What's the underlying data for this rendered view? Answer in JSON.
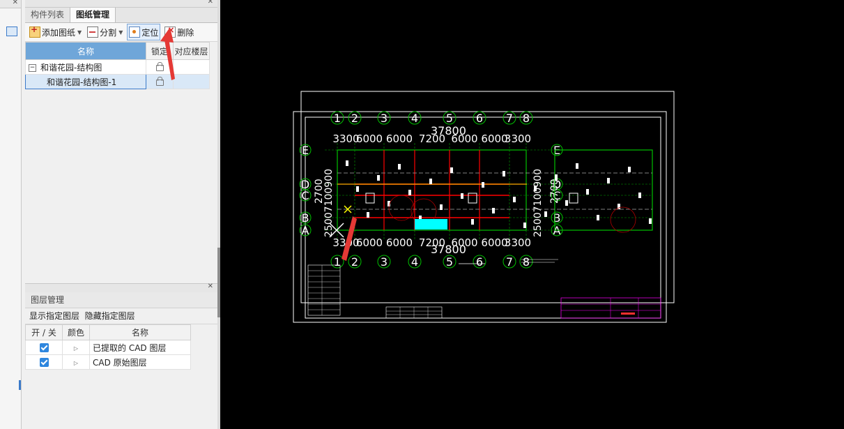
{
  "tabs": [
    {
      "label": "构件列表"
    },
    {
      "label": "图纸管理"
    }
  ],
  "toolbar": {
    "add_label": "添加图纸",
    "split_label": "分割",
    "locate_label": "定位",
    "delete_label": "删除"
  },
  "drawing_table": {
    "headers": {
      "name": "名称",
      "lock": "锁定",
      "floor": "对应楼层"
    },
    "parent": {
      "name": "和谐花园-结构图",
      "toggle": "−"
    },
    "child": {
      "name": "和谐花园-结构图-1"
    }
  },
  "layer_panel": {
    "title": "图层管理",
    "show_label": "显示指定图层",
    "hide_label": "隐藏指定图层",
    "headers": {
      "toggle": "开 / 关",
      "color": "颜色",
      "name": "名称"
    },
    "rows": [
      {
        "name": "已提取的 CAD 图层",
        "checked": true
      },
      {
        "name": "CAD 原始图层",
        "checked": true
      }
    ]
  },
  "cad": {
    "column_labels_top": [
      "1",
      "2",
      "3",
      "4",
      "5",
      "6",
      "7",
      "8"
    ],
    "column_labels_bottom": [
      "1",
      "2",
      "3",
      "4",
      "5",
      "6",
      "7",
      "8"
    ],
    "row_labels_left": [
      "E",
      "D",
      "C",
      "B",
      "A"
    ],
    "row_labels_right": [
      "E",
      "D",
      "C",
      "B",
      "A"
    ],
    "dims_top": [
      "3300",
      "6000",
      "6000",
      "7200",
      "6000",
      "6000",
      "3300"
    ],
    "dims_bottom": [
      "3300",
      "6000",
      "6000",
      "7200",
      "6000",
      "6000",
      "3300"
    ],
    "total_top": "37800",
    "total_bottom": "37800",
    "left_dims_text": "25007100900",
    "left_dims_text_2": "2700",
    "right_dims_text": "25007100900",
    "right_dims_text_2": "2700",
    "colors": {
      "background": "#000000",
      "accent_cyan": "#00ffff",
      "axis_green": "#00c000",
      "wall_red": "#ff0000",
      "marker_yellow": "#ffff00",
      "pointer_red": "#e53935"
    }
  }
}
